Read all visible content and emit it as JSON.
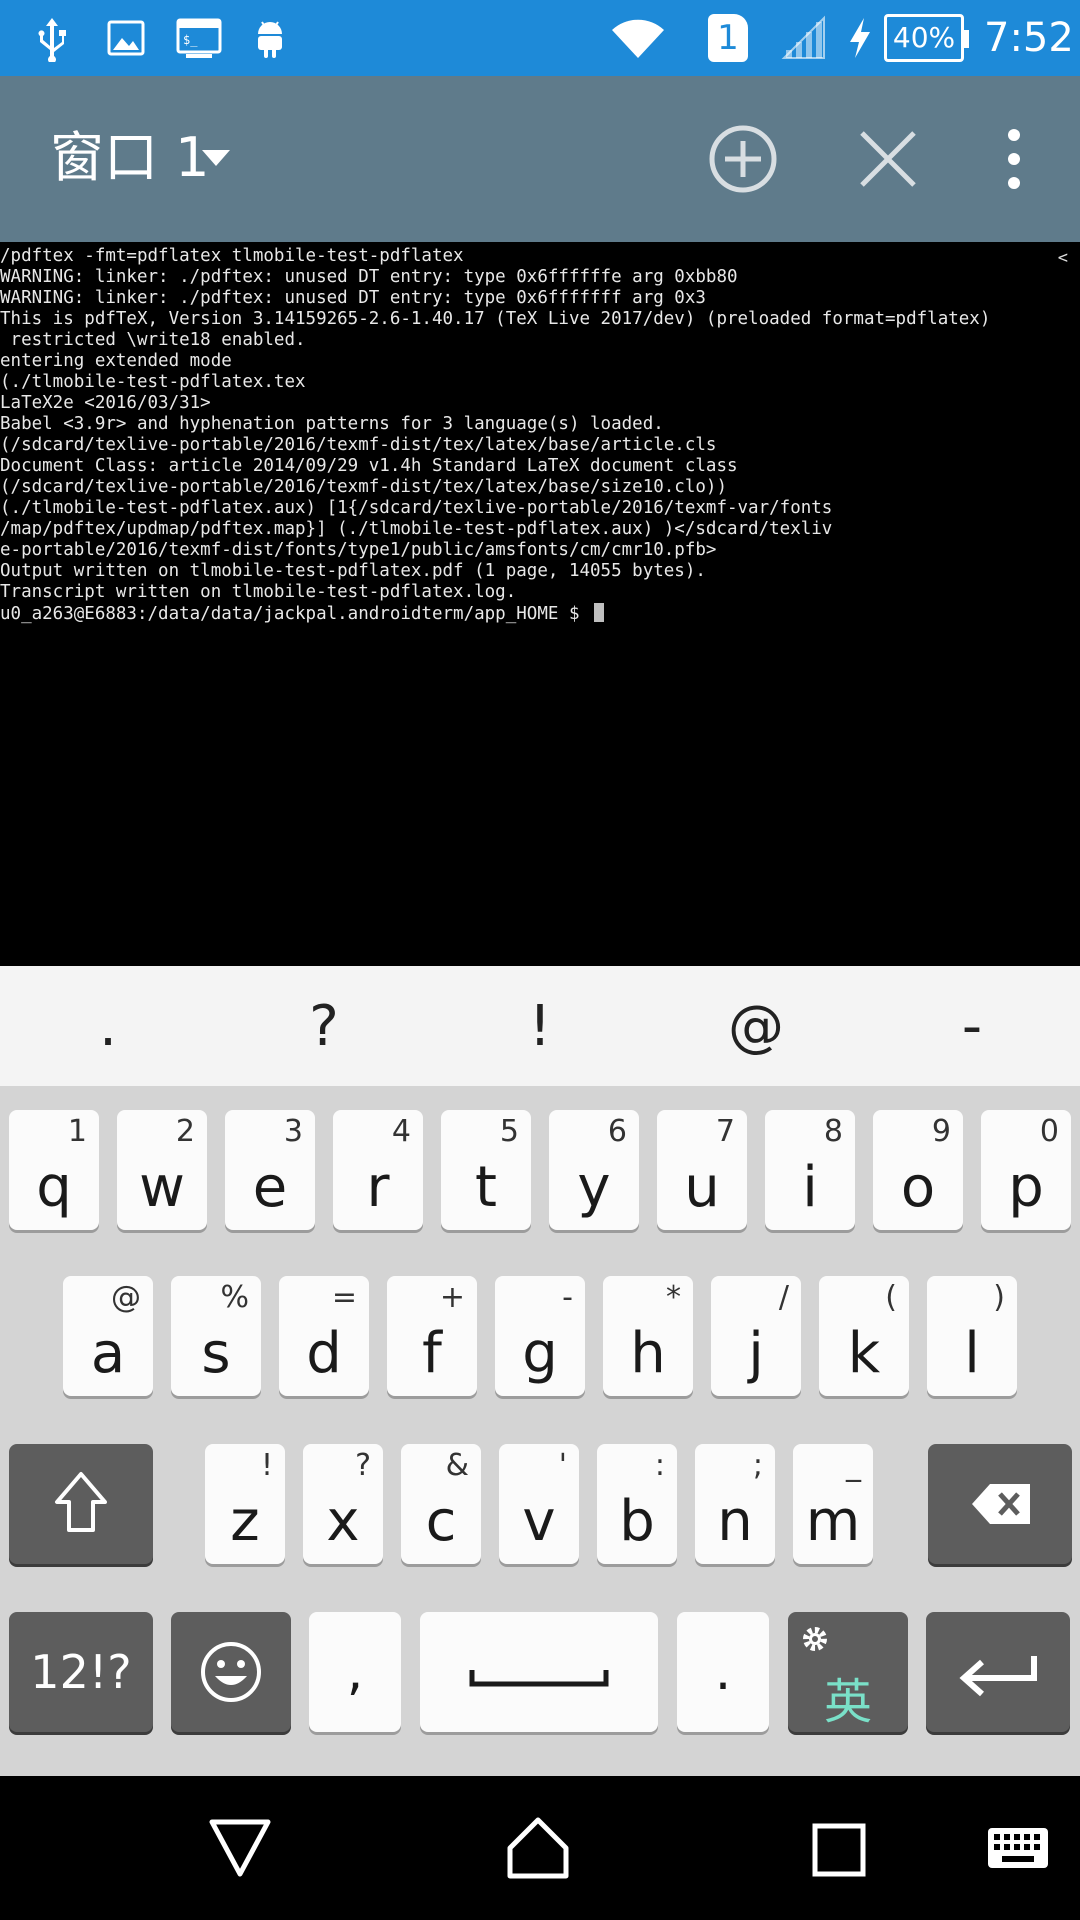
{
  "status_bar": {
    "battery_percent": "40%",
    "time": "7:52",
    "sim_slot": "1",
    "icons": [
      "usb-icon",
      "image-icon",
      "terminal-icon",
      "android-icon",
      "wifi-icon",
      "sim-icon",
      "signal-icon",
      "charging-icon",
      "battery-icon"
    ]
  },
  "action_bar": {
    "window_title": "窗口 1",
    "icons": [
      "dropdown-icon",
      "add-window-icon",
      "close-window-icon",
      "overflow-menu-icon"
    ]
  },
  "terminal": {
    "scroll_indicator": "<",
    "lines": [
      "/pdftex -fmt=pdflatex tlmobile-test-pdflatex",
      "WARNING: linker: ./pdftex: unused DT entry: type 0x6ffffffe arg 0xbb80",
      "WARNING: linker: ./pdftex: unused DT entry: type 0x6fffffff arg 0x3",
      "This is pdfTeX, Version 3.14159265-2.6-1.40.17 (TeX Live 2017/dev) (preloaded format=pdflatex)",
      " restricted \\write18 enabled.",
      "entering extended mode",
      "(./tlmobile-test-pdflatex.tex",
      "LaTeX2e <2016/03/31>",
      "Babel <3.9r> and hyphenation patterns for 3 language(s) loaded.",
      "(/sdcard/texlive-portable/2016/texmf-dist/tex/latex/base/article.cls",
      "Document Class: article 2014/09/29 v1.4h Standard LaTeX document class",
      "(/sdcard/texlive-portable/2016/texmf-dist/tex/latex/base/size10.clo))",
      "(./tlmobile-test-pdflatex.aux) [1{/sdcard/texlive-portable/2016/texmf-var/fonts",
      "/map/pdftex/updmap/pdftex.map}] (./tlmobile-test-pdflatex.aux) )</sdcard/texliv",
      "e-portable/2016/texmf-dist/fonts/type1/public/amsfonts/cm/cmr10.pfb>",
      "Output written on tlmobile-test-pdflatex.pdf (1 page, 14055 bytes).",
      "Transcript written on tlmobile-test-pdflatex.log.",
      "u0_a263@E6883:/data/data/jackpal.androidterm/app_HOME $ "
    ]
  },
  "suggestions": [
    ".",
    "?",
    "!",
    "@",
    "-"
  ],
  "keyboard": {
    "row1": [
      {
        "key": "q",
        "hint": "1"
      },
      {
        "key": "w",
        "hint": "2"
      },
      {
        "key": "e",
        "hint": "3"
      },
      {
        "key": "r",
        "hint": "4"
      },
      {
        "key": "t",
        "hint": "5"
      },
      {
        "key": "y",
        "hint": "6"
      },
      {
        "key": "u",
        "hint": "7"
      },
      {
        "key": "i",
        "hint": "8"
      },
      {
        "key": "o",
        "hint": "9"
      },
      {
        "key": "p",
        "hint": "0"
      }
    ],
    "row2": [
      {
        "key": "a",
        "hint": "@"
      },
      {
        "key": "s",
        "hint": "%"
      },
      {
        "key": "d",
        "hint": "="
      },
      {
        "key": "f",
        "hint": "+"
      },
      {
        "key": "g",
        "hint": "-"
      },
      {
        "key": "h",
        "hint": "*"
      },
      {
        "key": "j",
        "hint": "/"
      },
      {
        "key": "k",
        "hint": "("
      },
      {
        "key": "l",
        "hint": ")"
      }
    ],
    "row3": [
      {
        "key": "z",
        "hint": "!"
      },
      {
        "key": "x",
        "hint": "?"
      },
      {
        "key": "c",
        "hint": "&"
      },
      {
        "key": "v",
        "hint": "'"
      },
      {
        "key": "b",
        "hint": ":"
      },
      {
        "key": "n",
        "hint": ";"
      },
      {
        "key": "m",
        "hint": "_"
      }
    ],
    "symbols_label": "12!?",
    "comma_label": ",",
    "period_label": ".",
    "language_label": "英",
    "icons": [
      "shift-icon",
      "backspace-icon",
      "emoji-icon",
      "space-icon",
      "settings-icon",
      "enter-icon"
    ]
  },
  "nav_bar": {
    "icons": [
      "back-icon",
      "home-icon",
      "recents-icon",
      "keyboard-switch-icon"
    ]
  }
}
